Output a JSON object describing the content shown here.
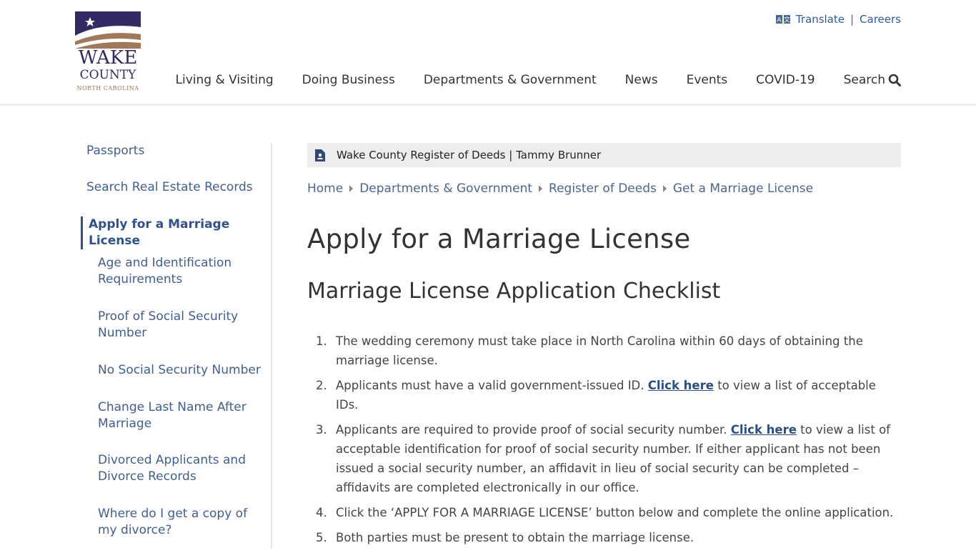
{
  "logo": {
    "line1": "WAKE",
    "line2": "COUNTY",
    "line3": "NORTH CAROLINA"
  },
  "utility": {
    "translate": "Translate",
    "separator": "|",
    "careers": "Careers"
  },
  "nav": {
    "items": [
      "Living & Visiting",
      "Doing Business",
      "Departments & Government",
      "News",
      "Events",
      "COVID-19"
    ],
    "search": "Search"
  },
  "sidebar": {
    "passports": "Passports",
    "search_records": "Search Real Estate Records",
    "active": "Apply for a Marriage License",
    "sub": [
      "Age and Identification Requirements",
      "Proof of Social Security Number",
      "No Social Security Number",
      "Change Last Name After Marriage",
      "Divorced Applicants and Divorce Records",
      "Where do I get a copy of my divorce?"
    ]
  },
  "banner": {
    "text": "Wake County Register of Deeds | Tammy Brunner"
  },
  "breadcrumb": [
    "Home",
    "Departments & Government",
    "Register of Deeds",
    "Get a Marriage License"
  ],
  "page_title": "Apply for a Marriage License",
  "section_title": "Marriage License Application Checklist",
  "checklist": {
    "item1": "The wedding ceremony must take place in North Carolina within 60 days of obtaining the marriage license.",
    "item2_pre": "Applicants must have a valid government-issued ID. ",
    "item2_link": "Click here",
    "item2_post": " to view a list of acceptable IDs.",
    "item3_pre": "Applicants are required to provide proof of social security number. ",
    "item3_link": "Click here",
    "item3_post": " to view a list of acceptable identification for proof of social security number. If either applicant has not been issued a social security number, an affidavit in lieu of social security can be completed – affidavits are completed electronically in our office.",
    "item4": "Click the ‘APPLY FOR A MARRIAGE LICENSE’ button below and complete the online application.",
    "item5": "Both parties must be present to obtain the marriage license.",
    "numbers": [
      "1.",
      "2.",
      "3.",
      "4.",
      "5."
    ]
  },
  "colors": {
    "brand_navy": "#312a63",
    "brand_brown": "#a0785a",
    "link_blue": "#3e5f92"
  },
  "icons": [
    "translate-icon",
    "search-icon",
    "document-user-icon",
    "caret-right-icon"
  ]
}
